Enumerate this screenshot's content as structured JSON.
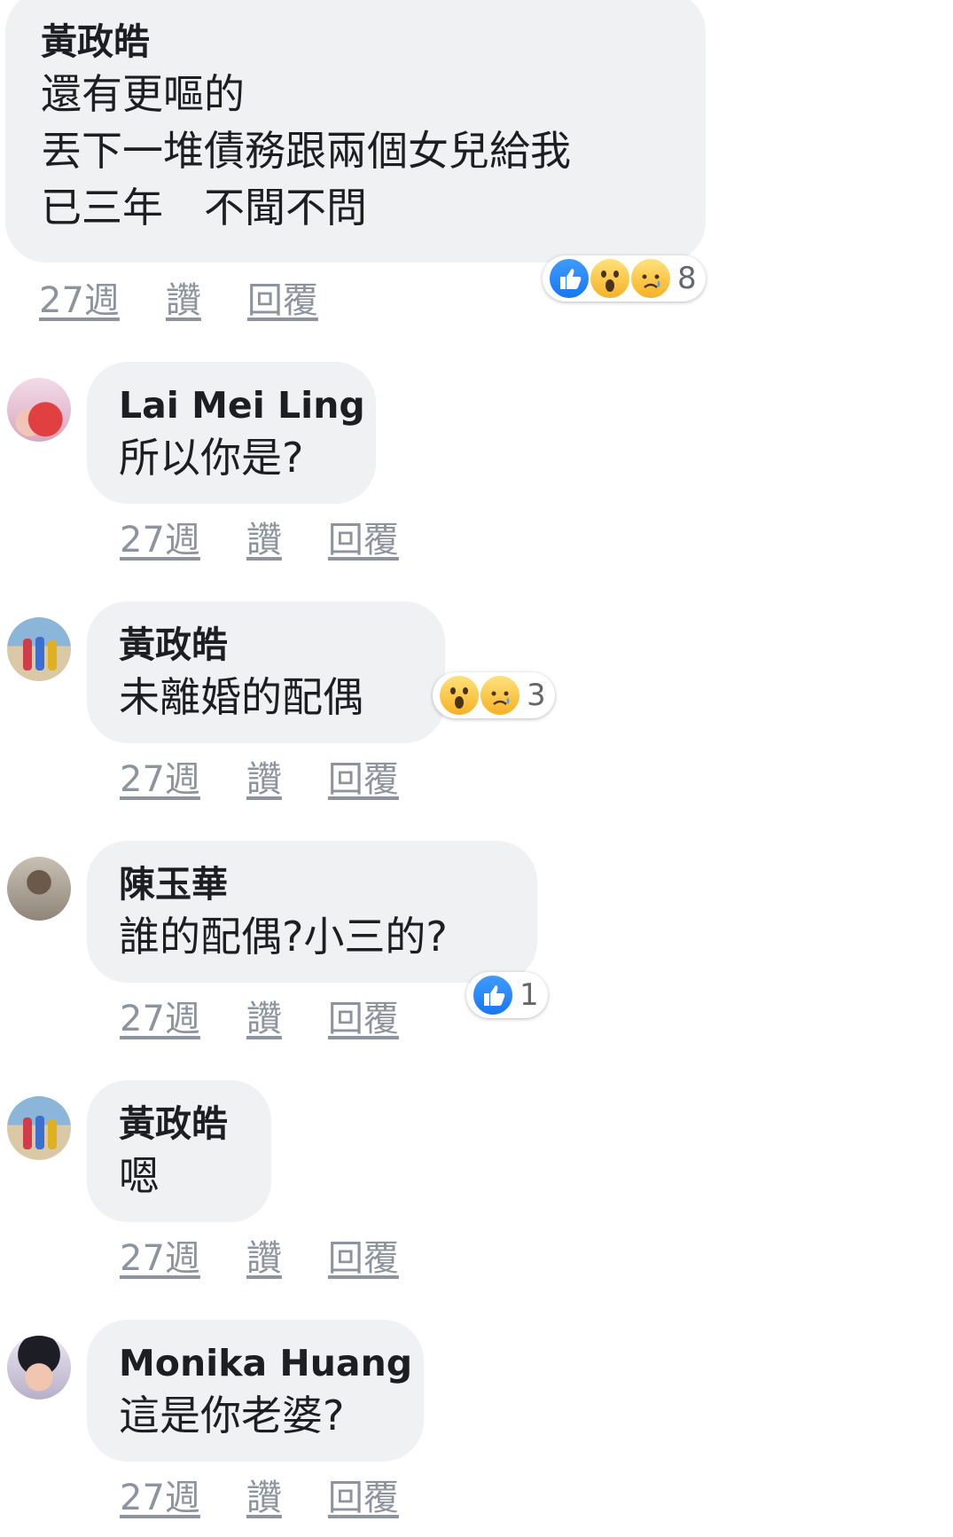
{
  "comments": [
    {
      "author": "黃政皓",
      "lines": [
        "還有更嘔的",
        "丟下一堆債務跟兩個女兒給我",
        "已三年　不聞不問"
      ],
      "time": "27週",
      "like_label": "讚",
      "reply_label": "回覆",
      "reactions": {
        "icons": [
          "like",
          "wow",
          "sad"
        ],
        "count": "8"
      }
    },
    {
      "author": "Lai Mei Ling",
      "lines": [
        "所以你是?"
      ],
      "time": "27週",
      "like_label": "讚",
      "reply_label": "回覆"
    },
    {
      "author": "黃政皓",
      "lines": [
        "未離婚的配偶"
      ],
      "time": "27週",
      "like_label": "讚",
      "reply_label": "回覆",
      "reactions": {
        "icons": [
          "wow",
          "sad"
        ],
        "count": "3"
      }
    },
    {
      "author": "陳玉華",
      "lines": [
        "誰的配偶?小三的?"
      ],
      "time": "27週",
      "like_label": "讚",
      "reply_label": "回覆",
      "reactions": {
        "icons": [
          "like"
        ],
        "count": "1"
      }
    },
    {
      "author": "黃政皓",
      "lines": [
        "嗯"
      ],
      "time": "27週",
      "like_label": "讚",
      "reply_label": "回覆"
    },
    {
      "author": "Monika Huang",
      "lines": [
        "這是你老婆?"
      ],
      "time": "27週",
      "like_label": "讚",
      "reply_label": "回覆"
    }
  ],
  "colors": {
    "bubble": "#f0f1f3",
    "link_gray": "#8d949e",
    "like_blue": "#1877f2",
    "emoji_yellow": "#f7b125"
  }
}
